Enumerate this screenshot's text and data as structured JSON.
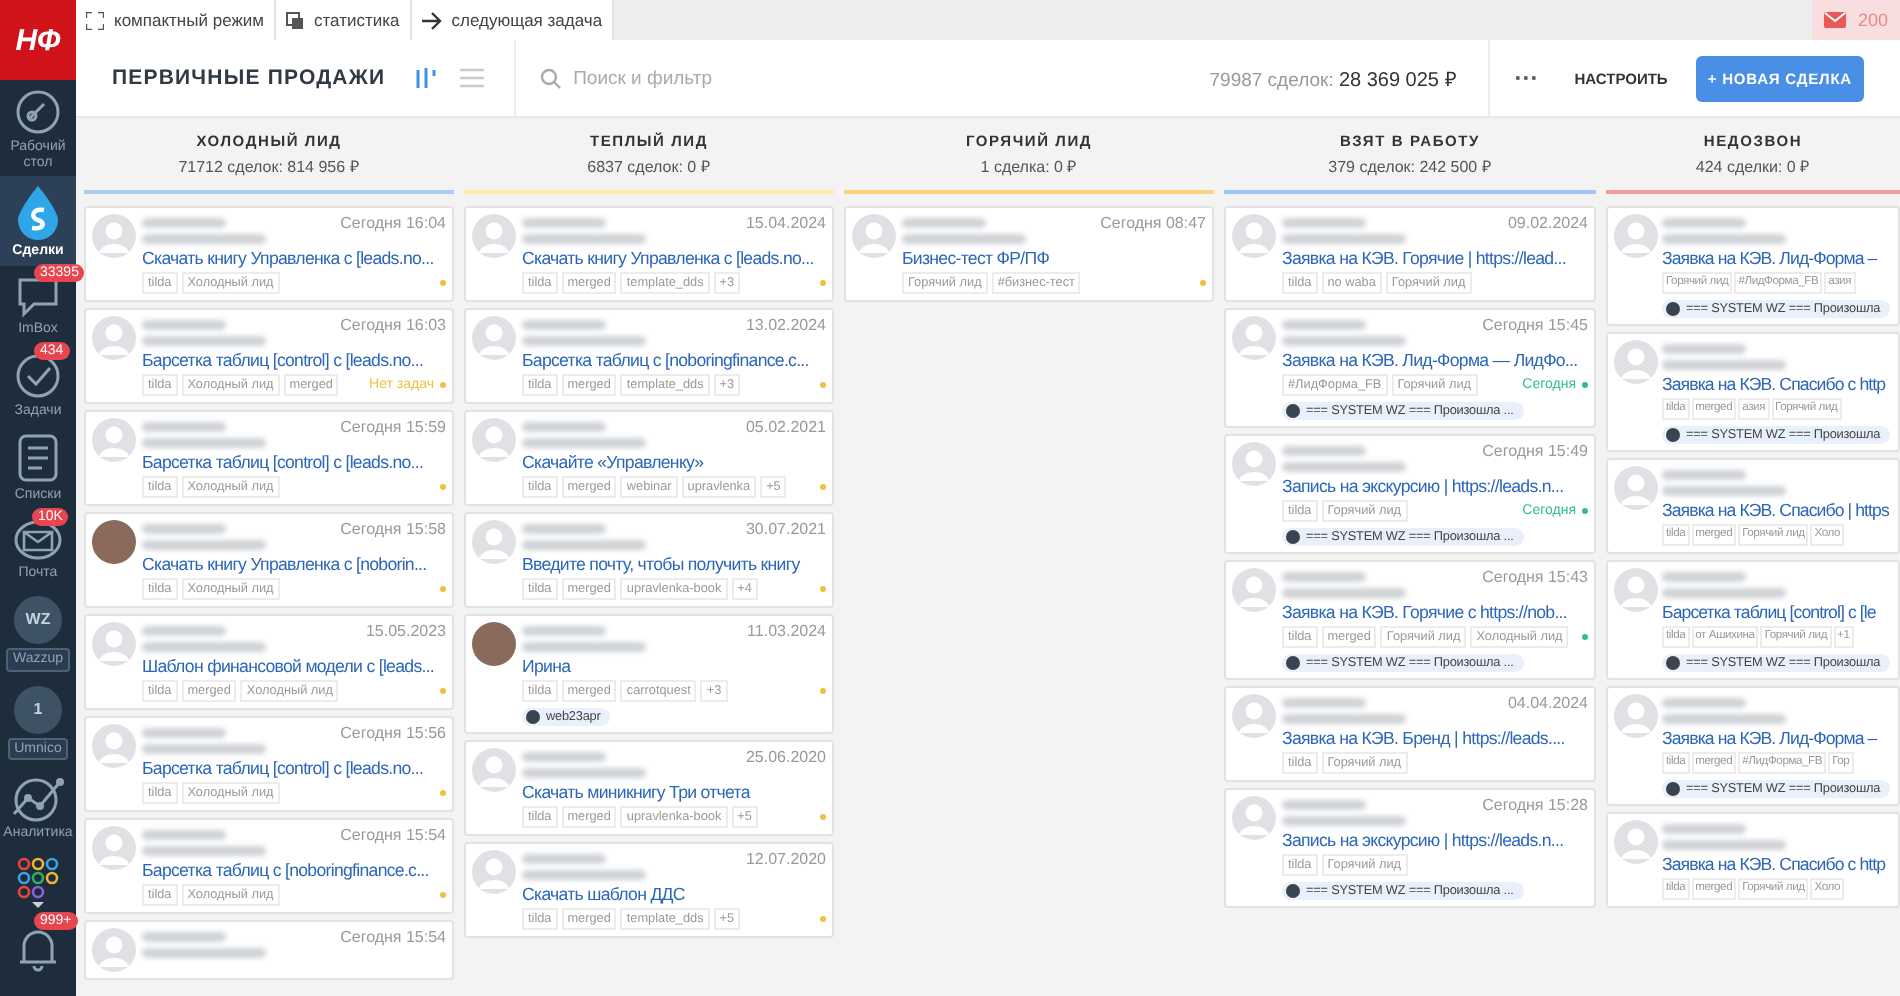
{
  "topbar": {
    "buttons": [
      {
        "kind": "expand",
        "label": "компактный режим"
      },
      {
        "kind": "stats",
        "label": "статистика"
      },
      {
        "kind": "arrow",
        "label": "следующая задача"
      }
    ],
    "mail_count": "200"
  },
  "sidebar": {
    "logo": "НФ",
    "items": [
      {
        "kind": "gauge",
        "label": "Рабочий стол",
        "selected": false
      },
      {
        "kind": "deals",
        "label": "Сделки",
        "selected": true
      },
      {
        "kind": "chat",
        "label": "ImBox",
        "badge": "33395",
        "selected": false
      },
      {
        "kind": "tasks",
        "label": "Задачи",
        "badge": "434",
        "selected": false
      },
      {
        "kind": "lists",
        "label": "Списки",
        "selected": false
      },
      {
        "kind": "mail",
        "label": "Почта",
        "badge": "10K",
        "selected": false
      },
      {
        "kind": "circle",
        "circle_text": "WZ",
        "label": "Wazzup",
        "selected": false
      },
      {
        "kind": "circle",
        "circle_text": "1",
        "label": "Umnico",
        "selected": false
      },
      {
        "kind": "analytics",
        "label": "Аналитика",
        "selected": false
      },
      {
        "kind": "apps",
        "selected": false
      },
      {
        "kind": "bell",
        "badge": "999+",
        "selected": false
      }
    ]
  },
  "header": {
    "title": "ПЕРВИЧНЫЕ ПРОДАЖИ",
    "views": [
      {
        "kind": "pipeline",
        "selected": true
      },
      {
        "kind": "list",
        "selected": false
      }
    ],
    "search": {
      "placeholder": "Поиск и фильтр"
    },
    "summary_label": "79987 сделок:",
    "summary_total": "28 369 025 ₽",
    "more_button": "···",
    "settings_button": "НАСТРОИТЬ",
    "new_button": "+ НОВАЯ СДЕЛКА"
  },
  "columns": [
    {
      "title": "ХОЛОДНЫЙ ЛИД",
      "summary": "71712 сделок: 814 956 ₽",
      "color": "#a9cdf3",
      "cards": [
        {
          "time": "Сегодня 16:04",
          "title": "Скачать книгу Управленка с [leads.no...",
          "tags": [
            "tilda",
            "Холодный лид"
          ],
          "color": "#f0c040",
          "has_photo": false
        },
        {
          "time": "Сегодня 16:03",
          "title": "Барсетка таблиц [control] с [leads.no...",
          "tags": [
            "tilda",
            "Холодный лид",
            "merged"
          ],
          "color": "#f0c040",
          "note": "Нет задач",
          "has_photo": false
        },
        {
          "time": "Сегодня 15:59",
          "title": "Барсетка таблиц [control] с [leads.no...",
          "tags": [
            "tilda",
            "Холодный лид"
          ],
          "color": "#f0c040",
          "has_photo": false
        },
        {
          "time": "Сегодня 15:58",
          "title": "Скачать книгу Управленка с [noborin...",
          "tags": [
            "tilda",
            "Холодный лид"
          ],
          "color": "#f0c040",
          "has_photo": true
        },
        {
          "time": "15.05.2023",
          "title": "Шаблон финансовой модели с [leads...",
          "tags": [
            "tilda",
            "merged",
            "Холодный лид"
          ],
          "color": "#f0c040",
          "has_photo": false
        },
        {
          "time": "Сегодня 15:56",
          "title": "Барсетка таблиц [control] с [leads.no...",
          "tags": [
            "tilda",
            "Холодный лид"
          ],
          "color": "#f0c040",
          "has_photo": false
        },
        {
          "time": "Сегодня 15:54",
          "title": "Барсетка таблиц с [noboringfinance.c...",
          "tags": [
            "tilda",
            "Холодный лид"
          ],
          "color": "#f0c040",
          "has_photo": false
        },
        {
          "time": "Сегодня 15:54",
          "has_photo": false
        }
      ]
    },
    {
      "title": "ТЕПЛЫЙ ЛИД",
      "summary": "6837 сделок: 0 ₽",
      "color": "#fbf0a0",
      "cards": [
        {
          "time": "15.04.2024",
          "title": "Скачать книгу Управленка с [leads.no...",
          "tags": [
            "tilda",
            "merged",
            "template_dds",
            "+3"
          ],
          "color": "#f0c040",
          "has_photo": false
        },
        {
          "time": "13.02.2024",
          "title": "Барсетка таблиц с [noboringfinance.c...",
          "tags": [
            "tilda",
            "merged",
            "template_dds",
            "+3"
          ],
          "color": "#f0c040",
          "has_photo": false
        },
        {
          "time": "05.02.2021",
          "title": "Скачайте «Управленку»",
          "tags": [
            "tilda",
            "merged",
            "webinar",
            "upravlenka",
            "+5"
          ],
          "color": "#f0c040",
          "has_photo": false
        },
        {
          "time": "30.07.2021",
          "title": "Введите почту, чтобы получить книгу",
          "tags": [
            "tilda",
            "merged",
            "upravlenka-book",
            "+4"
          ],
          "color": "#f0c040",
          "has_photo": false
        },
        {
          "time": "11.03.2024",
          "title": "Ирина",
          "tags": [
            "tilda",
            "merged",
            "carrotquest",
            "+3"
          ],
          "color": "#f0c040",
          "has_photo": true,
          "chip": "web23apr"
        },
        {
          "time": "25.06.2020",
          "title": "Скачать миникнигу Три отчета",
          "tags": [
            "tilda",
            "merged",
            "upravlenka-book",
            "+5"
          ],
          "color": "#f0c040",
          "has_photo": false
        },
        {
          "time": "12.07.2020",
          "title": "Скачать шаблон ДДС",
          "tags": [
            "tilda",
            "merged",
            "template_dds",
            "+5"
          ],
          "color": "#f0c040",
          "has_photo": false
        }
      ]
    },
    {
      "title": "ГОРЯЧИЙ ЛИД",
      "summary": "1 сделка: 0 ₽",
      "color": "#fbd27a",
      "cards": [
        {
          "time": "Сегодня 08:47",
          "title": "Бизнес-тест ФР/ПФ",
          "tags": [
            "Горячий лид",
            "#бизнес-тест"
          ],
          "color": "#f0c040",
          "has_photo": false
        }
      ]
    },
    {
      "title": "ВЗЯТ В РАБОТУ",
      "summary": "379 сделок: 242 500 ₽",
      "color": "#9ec8f5",
      "cards": [
        {
          "time": "09.02.2024",
          "title": "Заявка на КЭВ. Горячие | https://lead...",
          "tags": [
            "tilda",
            "no waba",
            "Горячий лид"
          ],
          "has_photo": false
        },
        {
          "time": "Сегодня 15:45",
          "title": "Заявка на КЭВ. Лид-Форма — ЛидФо...",
          "tags": [
            "#ЛидФорма_FB",
            "Горячий лид"
          ],
          "color": "#2fbf8a",
          "note": "Сегодня",
          "has_photo": false,
          "chip": "=== SYSTEM WZ === Произошла ..."
        },
        {
          "time": "Сегодня 15:49",
          "title": "Запись на экскурсию | https://leads.n...",
          "tags": [
            "tilda",
            "Горячий лид"
          ],
          "color": "#2fbf8a",
          "note": "Сегодня",
          "has_photo": false,
          "chip": "=== SYSTEM WZ === Произошла ..."
        },
        {
          "time": "Сегодня 15:43",
          "title": "Заявка на КЭВ. Горячие с https://nob...",
          "tags": [
            "tilda",
            "merged",
            "Горячий лид",
            "Холодный лид"
          ],
          "color": "#2fbf8a",
          "has_photo": false,
          "chip": "=== SYSTEM WZ === Произошла ..."
        },
        {
          "time": "04.04.2024",
          "title": "Заявка на КЭВ. Бренд | https://leads....",
          "tags": [
            "tilda",
            "Горячий лид"
          ],
          "has_photo": false
        },
        {
          "time": "Сегодня 15:28",
          "title": "Запись на экскурсию | https://leads.n...",
          "tags": [
            "tilda",
            "Горячий лид"
          ],
          "has_photo": false,
          "chip": "=== SYSTEM WZ === Произошла ..."
        }
      ]
    },
    {
      "title": "НЕДОЗВОН",
      "summary": "424 сделки: 0 ₽",
      "color": "#f59a9a",
      "cards": [
        {
          "title": "Заявка на КЭВ. Лид-Форма –",
          "tags": [
            "Горячий лид",
            "#ЛидФорма_FB",
            "азия"
          ],
          "has_photo": false,
          "chip": "=== SYSTEM WZ === Произошла"
        },
        {
          "title": "Заявка на КЭВ. Спасибо с http",
          "tags": [
            "tilda",
            "merged",
            "азия",
            "Горячий лид"
          ],
          "has_photo": false,
          "chip": "=== SYSTEM WZ === Произошла"
        },
        {
          "title": "Заявка на КЭВ. Спасибо | https",
          "tags": [
            "tilda",
            "merged",
            "Горячий лид",
            "Холо"
          ],
          "has_photo": false
        },
        {
          "title": "Барсетка таблиц [control] с [le",
          "tags": [
            "tilda",
            "от Ашихина",
            "Горячий лид",
            "+1"
          ],
          "has_photo": false,
          "chip": "=== SYSTEM WZ === Произошла"
        },
        {
          "title": "Заявка на КЭВ. Лид-Форма –",
          "tags": [
            "tilda",
            "merged",
            "#ЛидФорма_FB",
            "Гор"
          ],
          "has_photo": false,
          "chip": "=== SYSTEM WZ === Произошла"
        },
        {
          "title": "Заявка на КЭВ. Спасибо с http",
          "tags": [
            "tilda",
            "merged",
            "Горячий лид",
            "Холо"
          ],
          "has_photo": false
        }
      ]
    }
  ]
}
